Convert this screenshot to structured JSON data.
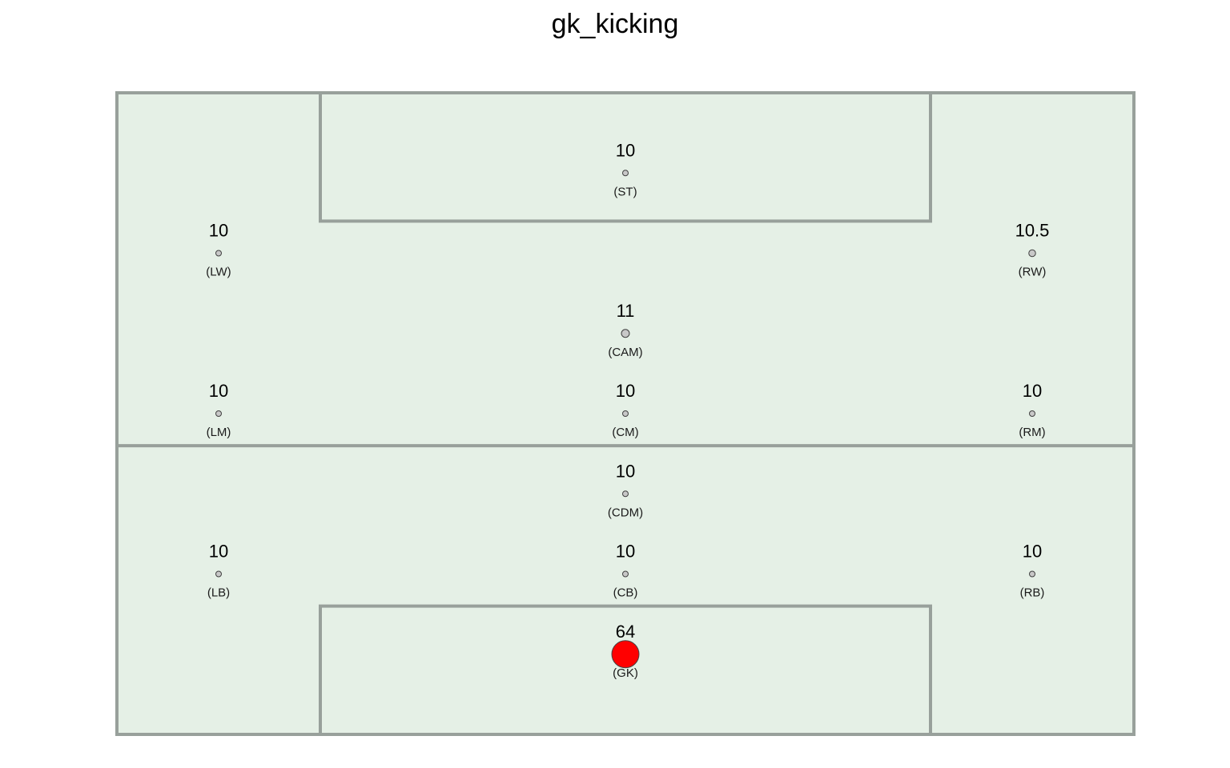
{
  "chart_data": {
    "type": "scatter",
    "title": "gk_kicking",
    "xlabel": "",
    "ylabel": "",
    "xlim": [
      0,
      5
    ],
    "ylim": [
      0,
      8
    ],
    "grid": false,
    "legend": "none",
    "colors": {
      "pitch_fill": "#e5f0e6",
      "pitch_line": "#98a09b",
      "point_fill": "#c8c8c8",
      "point_stroke": "#404040",
      "highlight_fill": "#ff0000",
      "highlight_stroke": "#444444"
    },
    "highlight_position": "GK",
    "points": [
      {
        "position": "ST",
        "label": "(ST)",
        "value": 10,
        "value_text": "10",
        "x": 2.5,
        "y": 7
      },
      {
        "position": "LW",
        "label": "(LW)",
        "value": 10,
        "value_text": "10",
        "x": 0.5,
        "y": 6
      },
      {
        "position": "RW",
        "label": "(RW)",
        "value": 10.5,
        "value_text": "10.5",
        "x": 4.5,
        "y": 6
      },
      {
        "position": "CAM",
        "label": "(CAM)",
        "value": 11,
        "value_text": "11",
        "x": 2.5,
        "y": 5
      },
      {
        "position": "LM",
        "label": "(LM)",
        "value": 10,
        "value_text": "10",
        "x": 0.5,
        "y": 4
      },
      {
        "position": "CM",
        "label": "(CM)",
        "value": 10,
        "value_text": "10",
        "x": 2.5,
        "y": 4
      },
      {
        "position": "RM",
        "label": "(RM)",
        "value": 10,
        "value_text": "10",
        "x": 4.5,
        "y": 4
      },
      {
        "position": "CDM",
        "label": "(CDM)",
        "value": 10,
        "value_text": "10",
        "x": 2.5,
        "y": 3
      },
      {
        "position": "LB",
        "label": "(LB)",
        "value": 10,
        "value_text": "10",
        "x": 0.5,
        "y": 2
      },
      {
        "position": "CB",
        "label": "(CB)",
        "value": 10,
        "value_text": "10",
        "x": 2.5,
        "y": 2
      },
      {
        "position": "RB",
        "label": "(RB)",
        "value": 10,
        "value_text": "10",
        "x": 4.5,
        "y": 2
      },
      {
        "position": "GK",
        "label": "(GK)",
        "value": 64,
        "value_text": "64",
        "x": 2.5,
        "y": 1
      }
    ]
  }
}
